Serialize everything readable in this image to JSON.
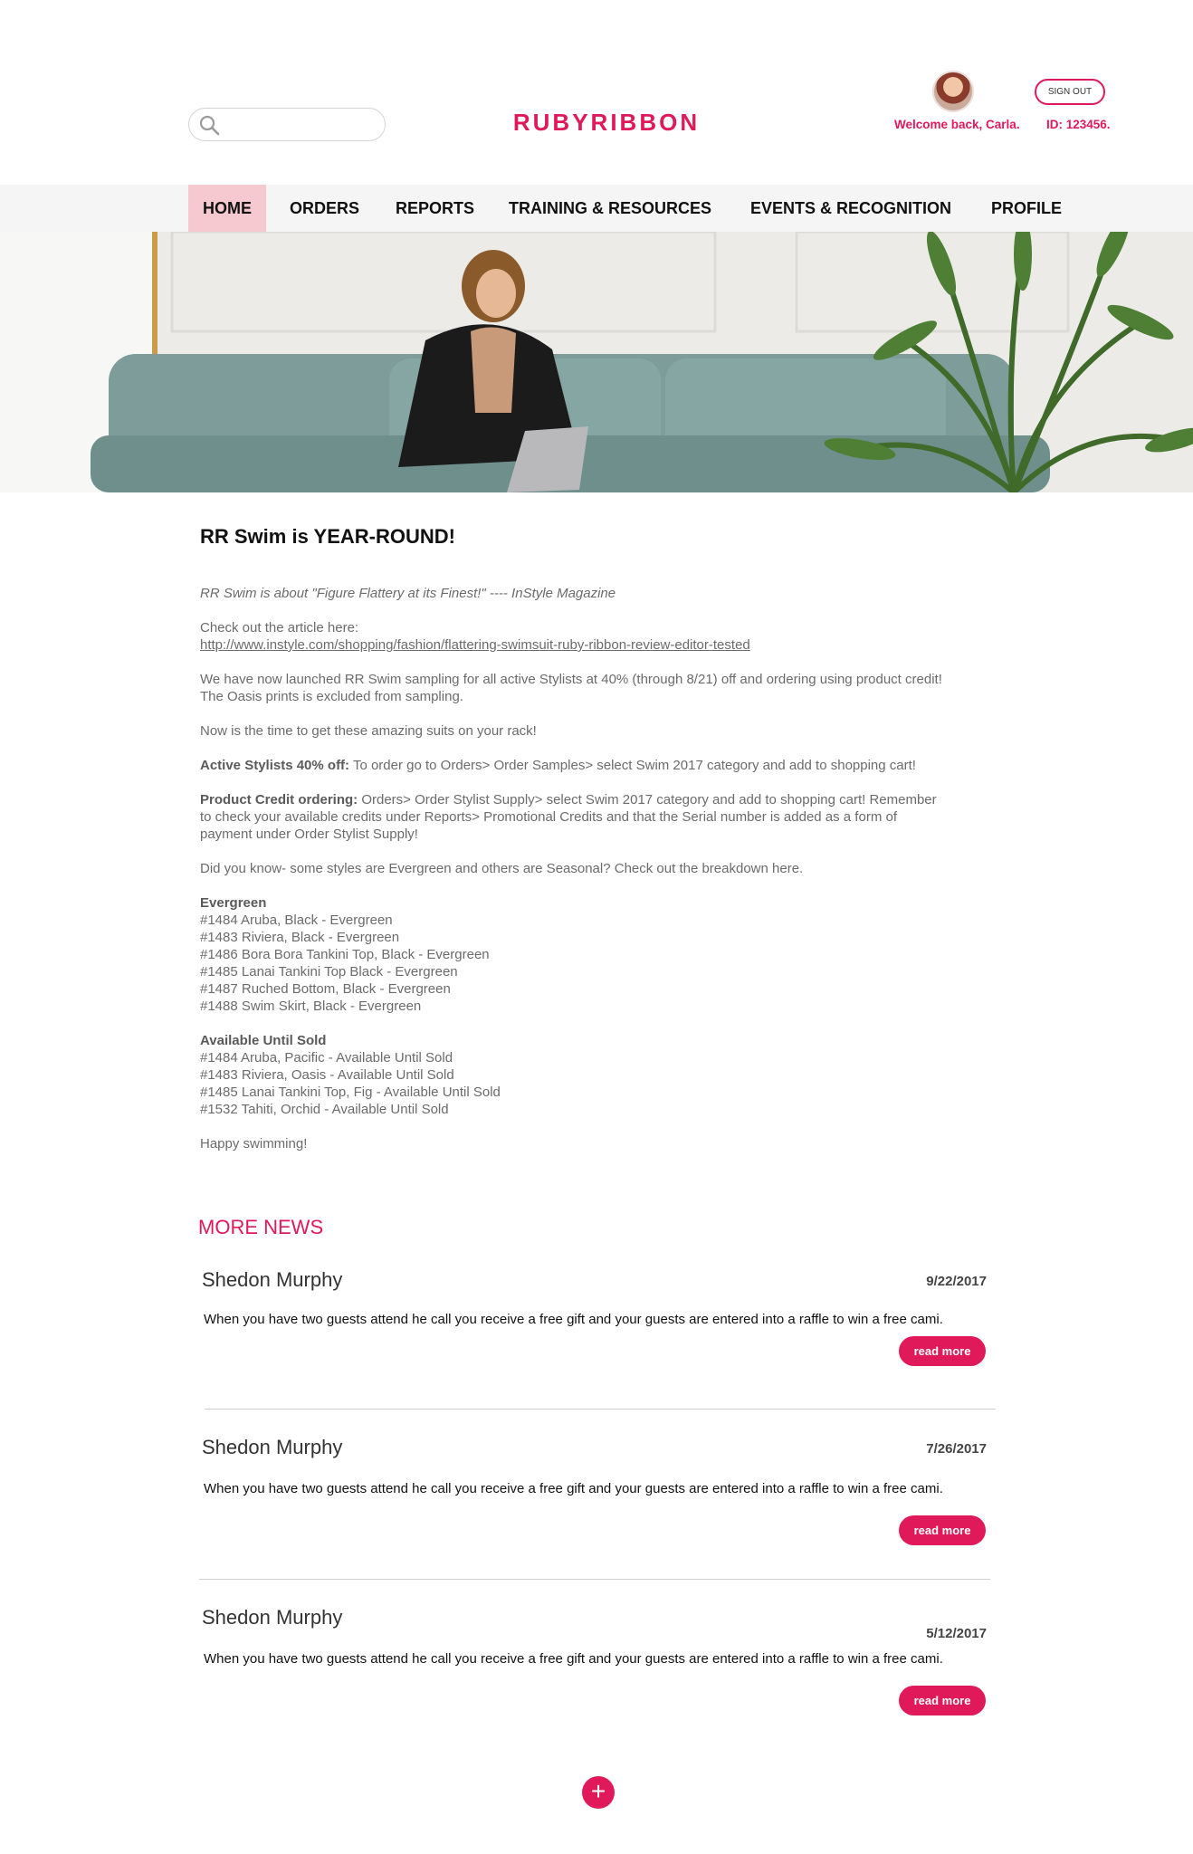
{
  "header": {
    "logo": "RUBYRIBBON",
    "search": {
      "placeholder": ""
    },
    "signout_label": "SIGN OUT",
    "welcome": "Welcome back, Carla.",
    "member_id": "ID: 123456."
  },
  "nav": {
    "items": [
      {
        "label": "HOME",
        "active": true
      },
      {
        "label": "ORDERS"
      },
      {
        "label": "REPORTS"
      },
      {
        "label": "TRAINING & RESOURCES"
      },
      {
        "label": "EVENTS & RECOGNITION"
      },
      {
        "label": "PROFILE"
      }
    ]
  },
  "article": {
    "title": "RR Swim is YEAR-ROUND!",
    "quote": "RR Swim is about \"Figure Flattery at its Finest!\" ---- InStyle Magazine",
    "check_out": "Check out the article here:",
    "link": "http://www.instyle.com/shopping/fashion/flattering-swimsuit-ruby-ribbon-review-editor-tested",
    "launch_line1": "We have now launched RR Swim sampling for all active Stylists at 40% (through 8/21) off and ordering using product credit!",
    "launch_line2": "The Oasis prints is excluded from sampling.",
    "now_time": "Now is the time to get these amazing suits on your rack!",
    "active_label": "Active Stylists 40% off:",
    "active_text": " To order go to Orders> Order Samples> select Swim 2017 category and add to shopping cart!",
    "credit_label": "Product Credit ordering:",
    "credit_text1": " Orders> Order Stylist Supply> select Swim 2017 category and add to shopping cart! Remember",
    "credit_text2": "to check your available credits under Reports> Promotional Credits and that the Serial number is added as a form of",
    "credit_text3": "payment under Order Stylist Supply!",
    "did_you_know": "Did you know- some styles are Evergreen and others are Seasonal? Check out the breakdown here.",
    "evergreen_title": "Evergreen",
    "evergreen": [
      "#1484 Aruba, Black - Evergreen",
      "#1483 Riviera, Black - Evergreen",
      "#1486 Bora Bora Tankini Top, Black - Evergreen",
      "#1485 Lanai Tankini Top Black - Evergreen",
      "#1487 Ruched Bottom, Black - Evergreen",
      "#1488 Swim Skirt, Black - Evergreen"
    ],
    "available_title": "Available Until Sold",
    "available": [
      "#1484 Aruba, Pacific - Available Until Sold",
      "#1483 Riviera, Oasis - Available Until Sold",
      "#1485 Lanai Tankini Top, Fig - Available Until Sold",
      "#1532 Tahiti, Orchid - Available Until Sold"
    ],
    "closing": "Happy swimming!"
  },
  "more_news": {
    "title": "MORE NEWS",
    "items": [
      {
        "author": "Shedon Murphy",
        "date": "9/22/2017",
        "text": "When you have two guests attend  he call you receive a free gift and your guests are entered into a raffle to win a free cami.",
        "button": "read more"
      },
      {
        "author": "Shedon Murphy",
        "date": "7/26/2017",
        "text": "When you have two guests attend  he call you receive a free gift and your guests are entered into a raffle to win a free cami.",
        "button": "read more"
      },
      {
        "author": "Shedon Murphy",
        "date": "5/12/2017",
        "text": "When you have two guests attend  he call you receive a free gift and your guests are entered into a raffle to win a free cami.",
        "button": "read more"
      }
    ],
    "add_label": "+"
  },
  "colors": {
    "brand": "#e0195a",
    "nav_active_bg": "#f5c9cf",
    "nav_bg": "#f5f5f5"
  },
  "icons": {
    "search": "search-icon",
    "add": "plus-icon"
  }
}
